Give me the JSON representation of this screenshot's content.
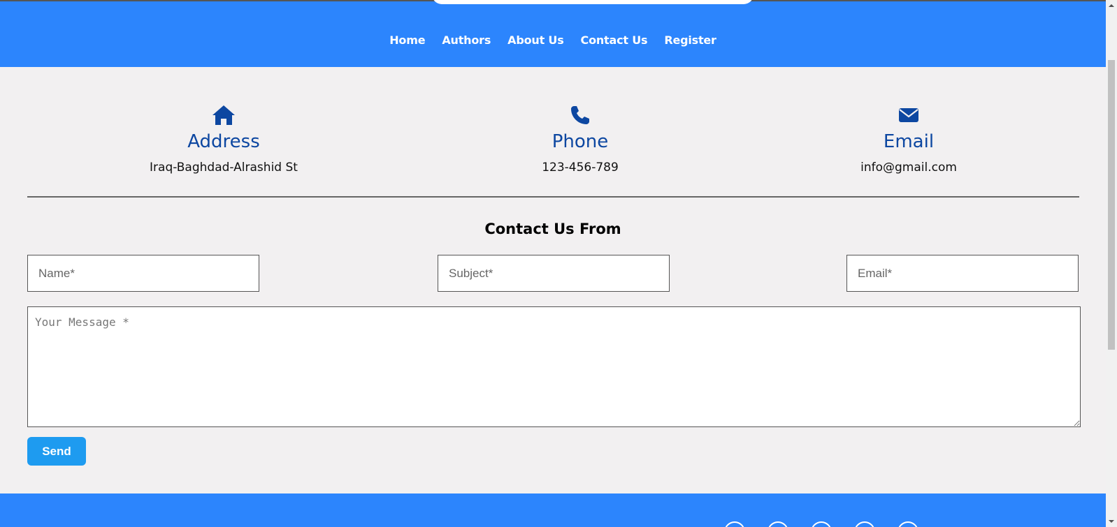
{
  "nav": {
    "items": [
      "Home",
      "Authors",
      "About Us",
      "Contact Us",
      "Register"
    ]
  },
  "info": {
    "address": {
      "icon": "home-icon",
      "title": "Address",
      "value": "Iraq-Baghdad-Alrashid St"
    },
    "phone": {
      "icon": "phone-icon",
      "title": "Phone",
      "value": "123-456-789"
    },
    "email": {
      "icon": "envelope-icon",
      "title": "Email",
      "value": "info@gmail.com"
    }
  },
  "form": {
    "title": "Contact Us From",
    "name_placeholder": "Name*",
    "subject_placeholder": "Subject*",
    "email_placeholder": "Email*",
    "message_placeholder": "Your Message *",
    "send_label": "Send"
  },
  "colors": {
    "header": "#2c85fd",
    "accent_text": "#0d47a1",
    "button": "#1e9bf0",
    "background": "#f2f0f1"
  }
}
